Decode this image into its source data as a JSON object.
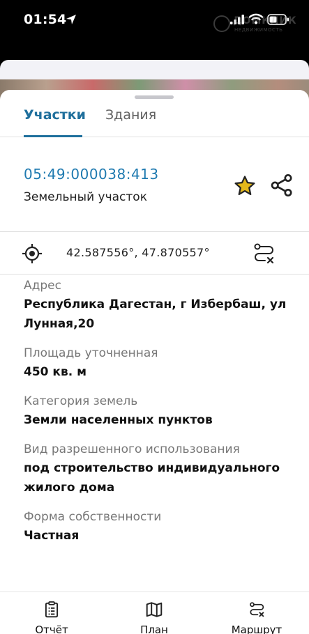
{
  "status_bar": {
    "time": "01:54",
    "icons": [
      "location-arrow-icon",
      "cellular-signal-icon",
      "wifi-icon",
      "battery-icon"
    ]
  },
  "watermark": {
    "brand": "ДОМКЛИК",
    "sub": "НЕДВИЖИМОСТЬ"
  },
  "tabs": [
    {
      "label": "Участки",
      "active": true
    },
    {
      "label": "Здания",
      "active": false
    }
  ],
  "parcel": {
    "cadastral_number": "05:49:000038:413",
    "object_type": "Земельный участок",
    "coordinates": "42.587556°, 47.870557°"
  },
  "fields": [
    {
      "label": "Адрес",
      "value": "Республика Дагестан, г Избербаш, ул Лунная,20"
    },
    {
      "label": "Площадь уточненная",
      "value": "450 кв. м"
    },
    {
      "label": "Категория земель",
      "value": "Земли населенных пунктов"
    },
    {
      "label": "Вид разрешенного использования",
      "value": "под строительство индивидуального жилого дома"
    },
    {
      "label": "Форма собственности",
      "value": "Частная"
    }
  ],
  "bottom_nav": [
    {
      "label": "Отчёт",
      "icon": "report-clipboard-icon"
    },
    {
      "label": "План",
      "icon": "map-plan-icon"
    },
    {
      "label": "Маршрут",
      "icon": "route-icon"
    }
  ],
  "colors": {
    "accent": "#1f6f9c",
    "link": "#1f7ab0",
    "star": "#e4b81a"
  }
}
